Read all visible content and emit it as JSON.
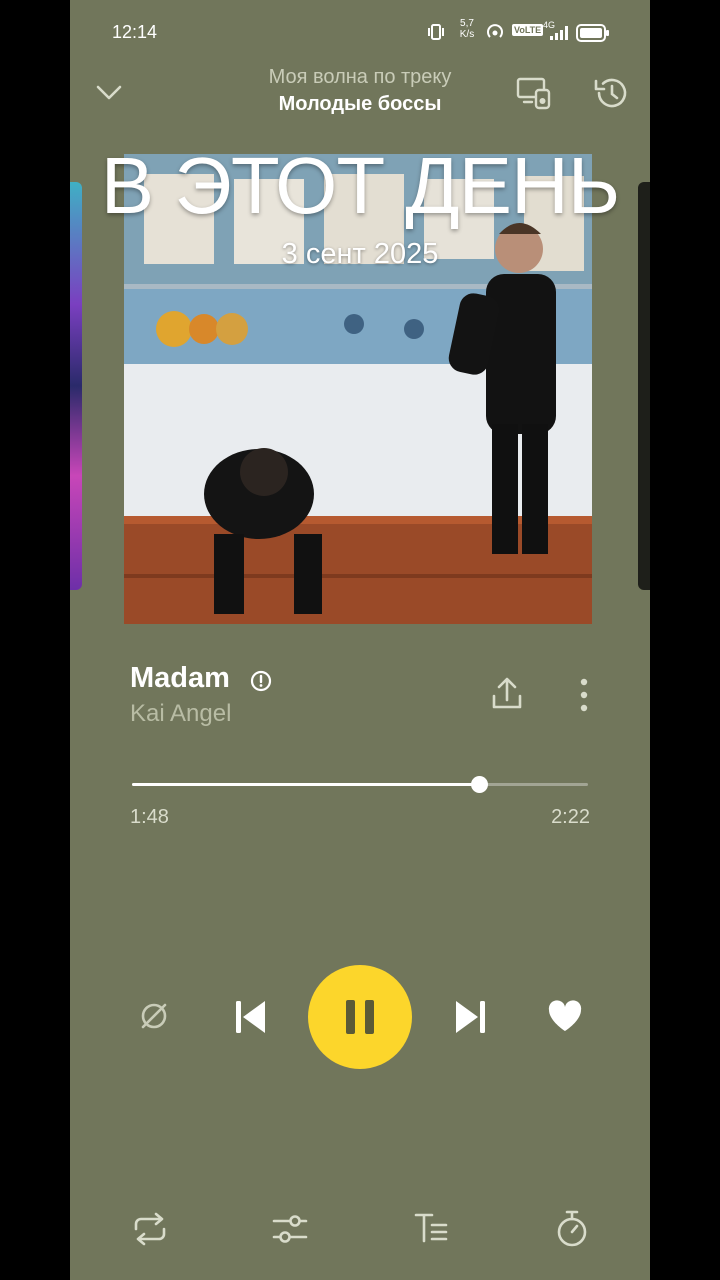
{
  "status_bar": {
    "time": "12:14",
    "net_speed_value": "5,7",
    "net_speed_unit": "K/s",
    "volte": "VoLTE",
    "network": "4G"
  },
  "header": {
    "subtitle": "Моя волна по треку",
    "title": "Молодые боссы"
  },
  "overlay": {
    "title": "В ЭТОТ ДЕНЬ",
    "date": "3 сент 2025"
  },
  "track": {
    "title": "Madam",
    "artist": "Kai Angel"
  },
  "progress": {
    "elapsed": "1:48",
    "total": "2:22",
    "fraction": 0.761
  },
  "colors": {
    "background": "#71765b",
    "accent": "#fcd62b",
    "text": "#ffffff",
    "muted": "#c9ccb8"
  },
  "icons": {
    "collapse": "chevron-down-icon",
    "cast": "cast-device-icon",
    "history": "history-icon",
    "explicit": "explicit-icon",
    "share": "share-icon",
    "more": "more-vertical-icon",
    "dislike": "dislike-icon",
    "previous": "previous-icon",
    "pause": "pause-icon",
    "next": "next-icon",
    "like": "heart-icon",
    "repeat": "repeat-icon",
    "equalizer": "equalizer-icon",
    "lyrics": "lyrics-icon",
    "timer": "timer-icon"
  }
}
